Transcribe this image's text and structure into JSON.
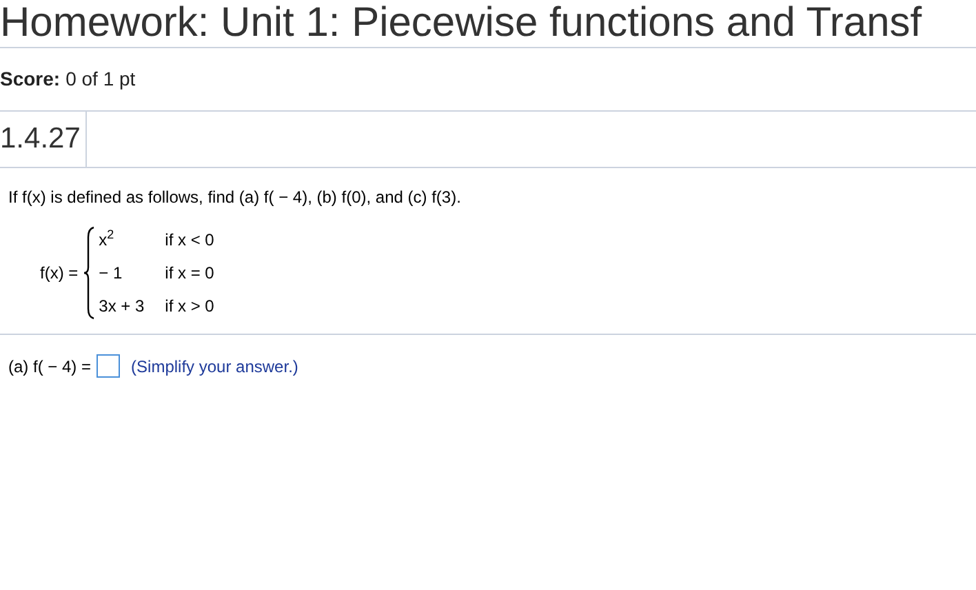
{
  "title": "Homework: Unit 1: Piecewise functions and Transf",
  "score": {
    "label": "Score:",
    "value": "0 of 1 pt"
  },
  "question_number": "1.4.27",
  "prompt": "If f(x) is defined as follows, find (a) f( − 4), (b) f(0), and (c) f(3).",
  "function": {
    "lhs": "f(x) =",
    "cases": [
      {
        "expression": "x$^{2}$",
        "condition": "if x < 0"
      },
      {
        "expression": "− 1",
        "condition": "if x = 0"
      },
      {
        "expression": "3x + 3",
        "condition": "if x > 0"
      }
    ]
  },
  "answer": {
    "label": "(a) f( − 4) =",
    "hint": "(Simplify your answer.)"
  }
}
